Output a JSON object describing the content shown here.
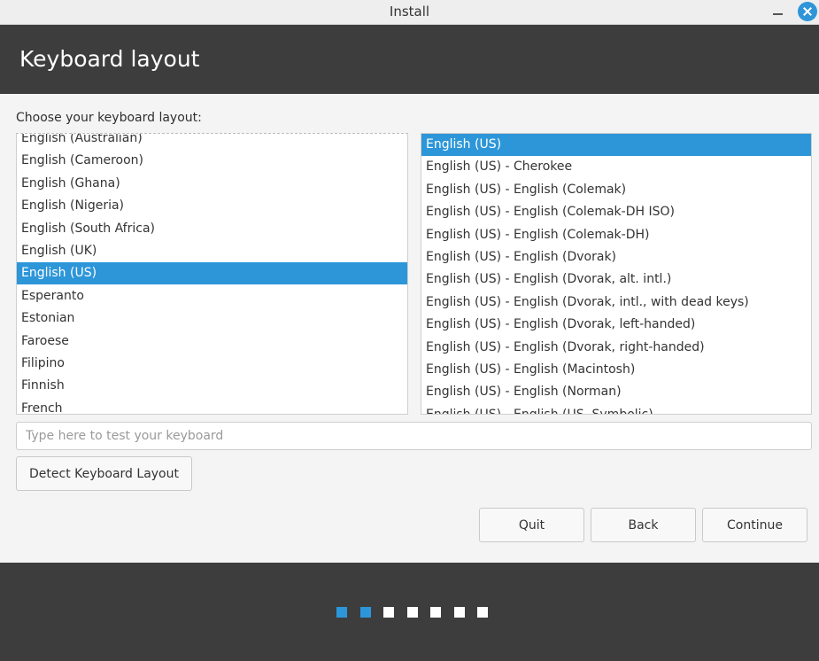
{
  "window": {
    "title": "Install",
    "minimize_icon": "minimize-icon",
    "close_icon": "close-icon",
    "close_color": "#2f95d8"
  },
  "header": {
    "title": "Keyboard layout",
    "background": "#3d3d3d"
  },
  "main": {
    "prompt": "Choose your keyboard layout:",
    "accent_color": "#2d96d9",
    "layouts": {
      "selected": "English (US)",
      "items": [
        "English (Australian)",
        "English (Cameroon)",
        "English (Ghana)",
        "English (Nigeria)",
        "English (South Africa)",
        "English (UK)",
        "English (US)",
        "Esperanto",
        "Estonian",
        "Faroese",
        "Filipino",
        "Finnish",
        "French"
      ]
    },
    "variants": {
      "selected": "English (US)",
      "items": [
        "English (US)",
        "English (US) - Cherokee",
        "English (US) - English (Colemak)",
        "English (US) - English (Colemak-DH ISO)",
        "English (US) - English (Colemak-DH)",
        "English (US) - English (Dvorak)",
        "English (US) - English (Dvorak, alt. intl.)",
        "English (US) - English (Dvorak, intl., with dead keys)",
        "English (US) - English (Dvorak, left-handed)",
        "English (US) - English (Dvorak, right-handed)",
        "English (US) - English (Macintosh)",
        "English (US) - English (Norman)",
        "English (US) - English (US, Symbolic)"
      ]
    },
    "test_input": {
      "value": "",
      "placeholder": "Type here to test your keyboard"
    },
    "detect_button": "Detect Keyboard Layout",
    "buttons": {
      "quit": "Quit",
      "back": "Back",
      "continue": "Continue"
    }
  },
  "footer": {
    "progress": {
      "total_steps": 7,
      "completed_steps": 2
    }
  }
}
